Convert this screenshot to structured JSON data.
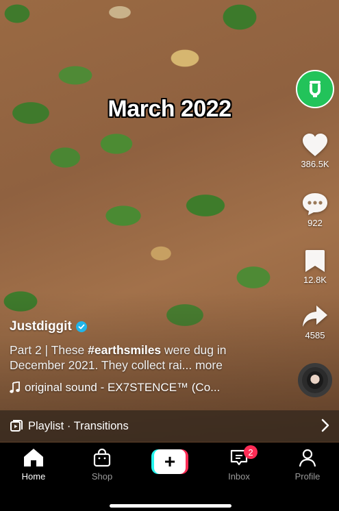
{
  "video": {
    "overlay_text": "March 2022"
  },
  "rail": {
    "likes": "386.5K",
    "comments": "922",
    "saves": "12.8K",
    "shares": "4585"
  },
  "caption": {
    "username": "Justdiggit",
    "desc_prefix": "Part 2 | These ",
    "hashtag": "#earthsmiles",
    "desc_suffix": " were dug in December 2021. They collect rai... ",
    "more": "more",
    "sound": "original sound - EX7STENCE™ (Co..."
  },
  "playlist": {
    "label": "Playlist · Transitions"
  },
  "tabbar": {
    "home": "Home",
    "shop": "Shop",
    "inbox": "Inbox",
    "inbox_badge": "2",
    "profile": "Profile",
    "create_symbol": "+"
  }
}
